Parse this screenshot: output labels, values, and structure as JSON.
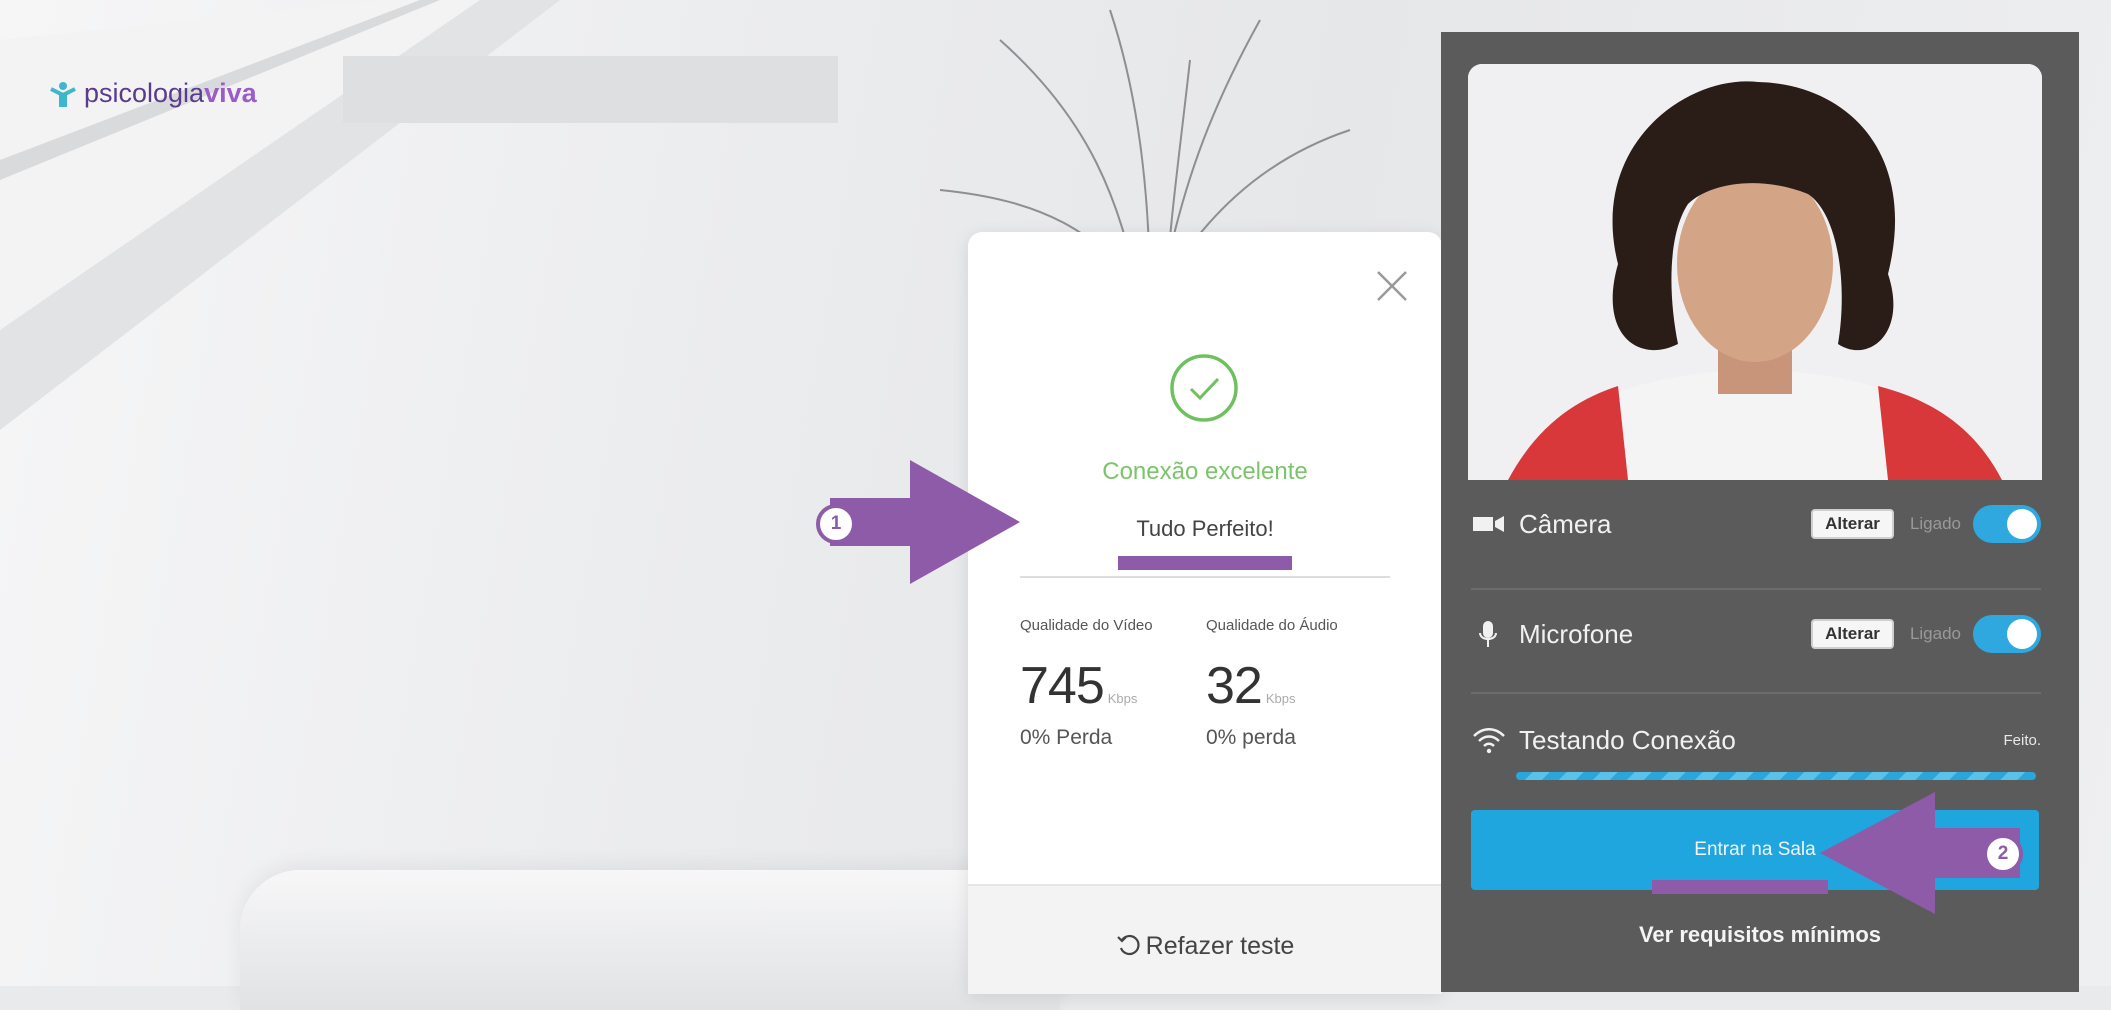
{
  "logo": {
    "part1": "psicologia",
    "part2": "viva",
    "icon": "psicologiaviva-logo-icon"
  },
  "connection_card": {
    "status": "Conexão excelente",
    "message": "Tudo Perfeito!",
    "video": {
      "label": "Qualidade do Vídeo",
      "value": "745",
      "unit": "Kbps",
      "loss": "0% Perda"
    },
    "audio": {
      "label": "Qualidade do Áudio",
      "value": "32",
      "unit": "Kbps",
      "loss": "0% perda"
    },
    "redo_label": "Refazer teste"
  },
  "device_panel": {
    "camera": {
      "label": "Câmera",
      "button": "Alterar",
      "state": "Ligado",
      "on": true
    },
    "microphone": {
      "label": "Microfone",
      "button": "Alterar",
      "state": "Ligado",
      "on": true
    },
    "connection": {
      "label": "Testando Conexão",
      "state": "Feito.",
      "progress": 1.0
    },
    "enter_button": "Entrar na Sala",
    "requirements_link": "Ver requisitos mínimos"
  },
  "annotations": {
    "step1": "1",
    "step2": "2"
  },
  "colors": {
    "accent_purple": "#8d5ba8",
    "primary_blue": "#1fa6df",
    "success_green": "#7cc46a",
    "panel_gray": "#5b5b5c"
  }
}
